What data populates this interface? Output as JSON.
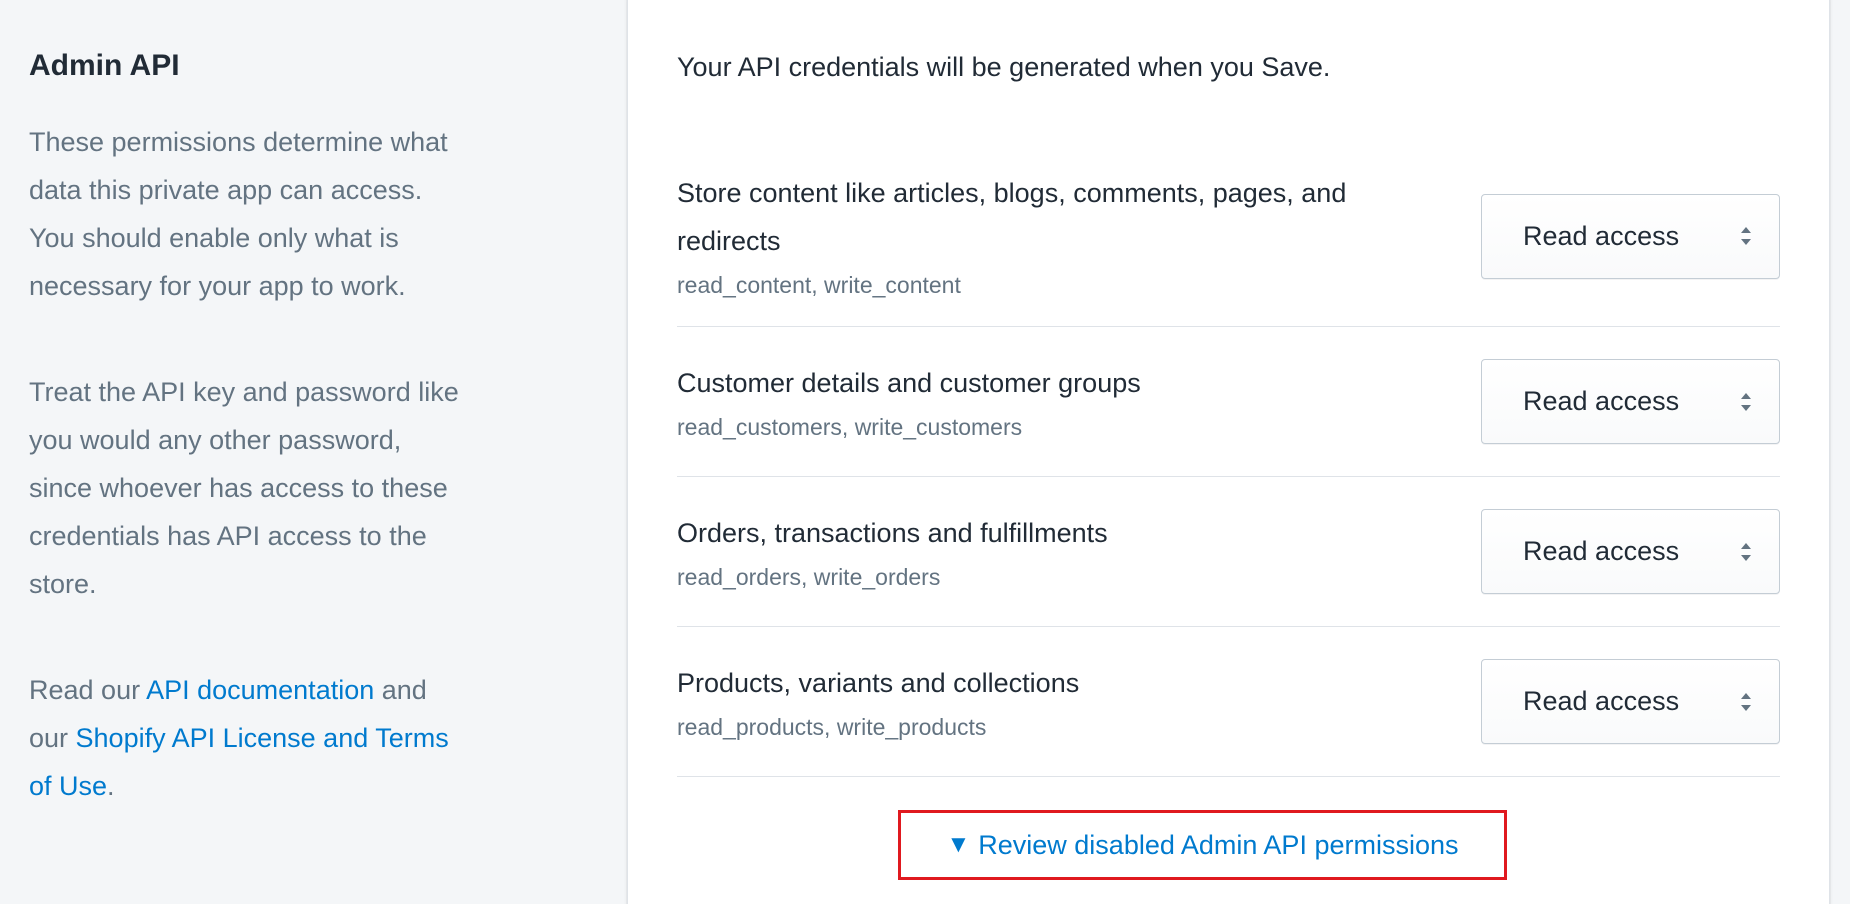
{
  "sidebar": {
    "title": "Admin API",
    "para1": "These permissions determine what data this private app can access. You should enable only what is necessary for your app to work.",
    "para2": "Treat the API key and password like you would any other password, since whoever has access to these credentials has API access to the store.",
    "para3_prefix": "Read our ",
    "para3_link1": "API documentation",
    "para3_middle": " and our ",
    "para3_link2": "Shopify API License and Terms of Use",
    "para3_suffix": "."
  },
  "card": {
    "intro": "Your API credentials will be generated when you Save.",
    "permissions": [
      {
        "title": "Store content like articles, blogs, comments, pages, and redirects",
        "scopes": "read_content, write_content",
        "access": "Read access"
      },
      {
        "title": "Customer details and customer groups",
        "scopes": "read_customers, write_customers",
        "access": "Read access"
      },
      {
        "title": "Orders, transactions and fulfillments",
        "scopes": "read_orders, write_orders",
        "access": "Read access"
      },
      {
        "title": "Products, variants and collections",
        "scopes": "read_products, write_products",
        "access": "Read access"
      }
    ],
    "review_triangle": "▼",
    "review_label": "Review disabled Admin API permissions"
  },
  "colors": {
    "link": "#007ace",
    "highlight_border": "#e0191f",
    "background": "#f4f6f8"
  }
}
